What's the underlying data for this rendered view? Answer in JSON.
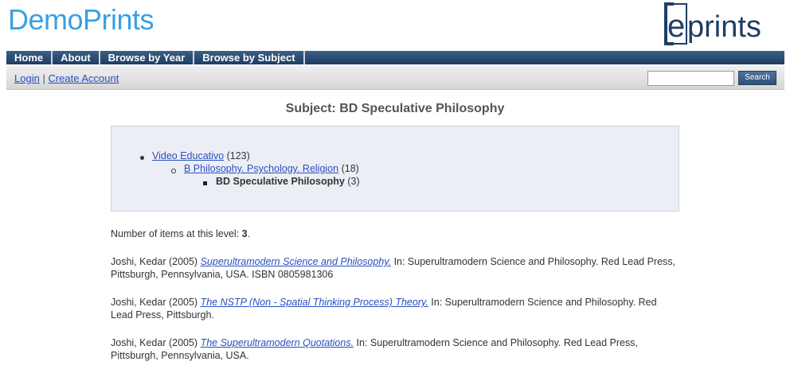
{
  "header": {
    "site_title": "DemoPrints",
    "logo_text": "eprints"
  },
  "menu": {
    "items": [
      {
        "label": "Home"
      },
      {
        "label": "About"
      },
      {
        "label": "Browse by Year"
      },
      {
        "label": "Browse by Subject"
      }
    ]
  },
  "toolbar": {
    "login": "Login",
    "separator": "|",
    "create_account": "Create Account",
    "search_value": "",
    "search_button": "Search"
  },
  "page": {
    "title": "Subject: BD Speculative Philosophy"
  },
  "subject_tree": [
    {
      "label": "Video Educativo",
      "count": "(123)",
      "link": true
    },
    {
      "label": "B Philosophy. Psychology. Religion",
      "count": "(18)",
      "link": true
    },
    {
      "label": "BD Speculative Philosophy",
      "count": "(3)",
      "link": false
    }
  ],
  "items_count": {
    "prefix": "Number of items at this level:",
    "value": "3",
    "suffix": "."
  },
  "results": [
    {
      "authors": "Joshi, Kedar (2005)",
      "title": "Superultramodern Science and Philosophy.",
      "rest": "In: Superultramodern Science and Philosophy. Red Lead Press, Pittsburgh, Pennsylvania, USA. ISBN 0805981306"
    },
    {
      "authors": "Joshi, Kedar (2005)",
      "title": "The NSTP (Non - Spatial Thinking Process) Theory.",
      "rest": "In: Superultramodern Science and Philosophy. Red Lead Press, Pittsburgh."
    },
    {
      "authors": "Joshi, Kedar (2005)",
      "title": "The Superultramodern Quotations.",
      "rest": "In: Superultramodern Science and Philosophy. Red Lead Press, Pittsburgh, Pennsylvania, USA."
    }
  ],
  "colors": {
    "site_title": "#3aa0e0",
    "menubar": "#2b4c73",
    "link": "#2a4fc0",
    "subject_box": "#eceef5",
    "logo": "#1f3d66"
  }
}
